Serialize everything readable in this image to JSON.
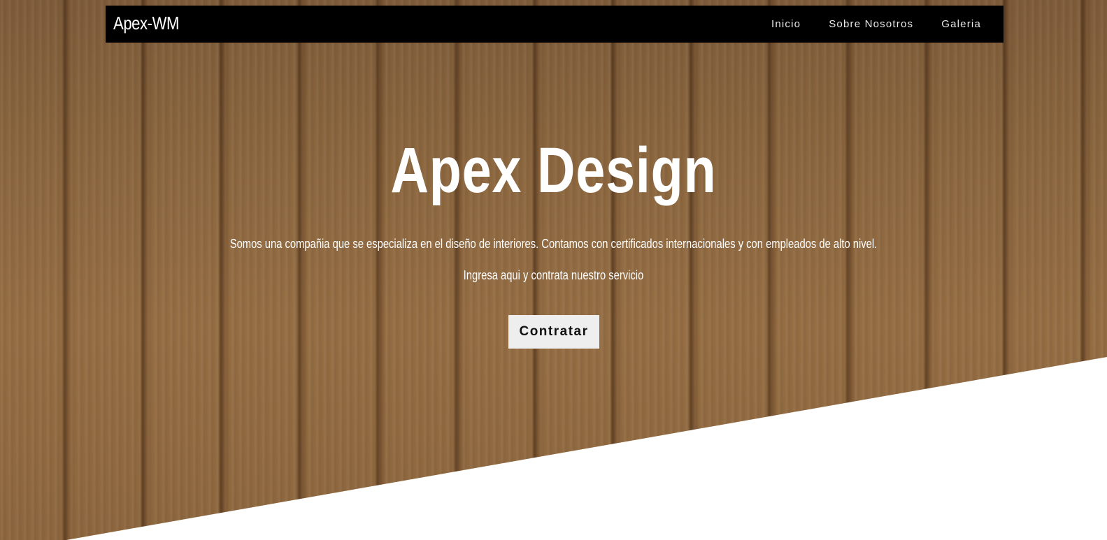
{
  "navbar": {
    "brand": "Apex-WM",
    "links": [
      {
        "label": "Inicio"
      },
      {
        "label": "Sobre Nosotros"
      },
      {
        "label": "Galeria"
      }
    ]
  },
  "hero": {
    "title": "Apex Design",
    "tagline": "Somos una compañia que se especializa en el diseño de interiores. Contamos con certificados internacionales y con empleados de alto nivel.",
    "subtagline": "Ingresa aqui y contrata nuestro servicio",
    "cta_label": "Contratar"
  },
  "colors": {
    "navbar_bg": "#000000",
    "wood_base": "#a57a4c",
    "cta_bg": "#eeeeee",
    "section_bg": "#ffffff"
  }
}
